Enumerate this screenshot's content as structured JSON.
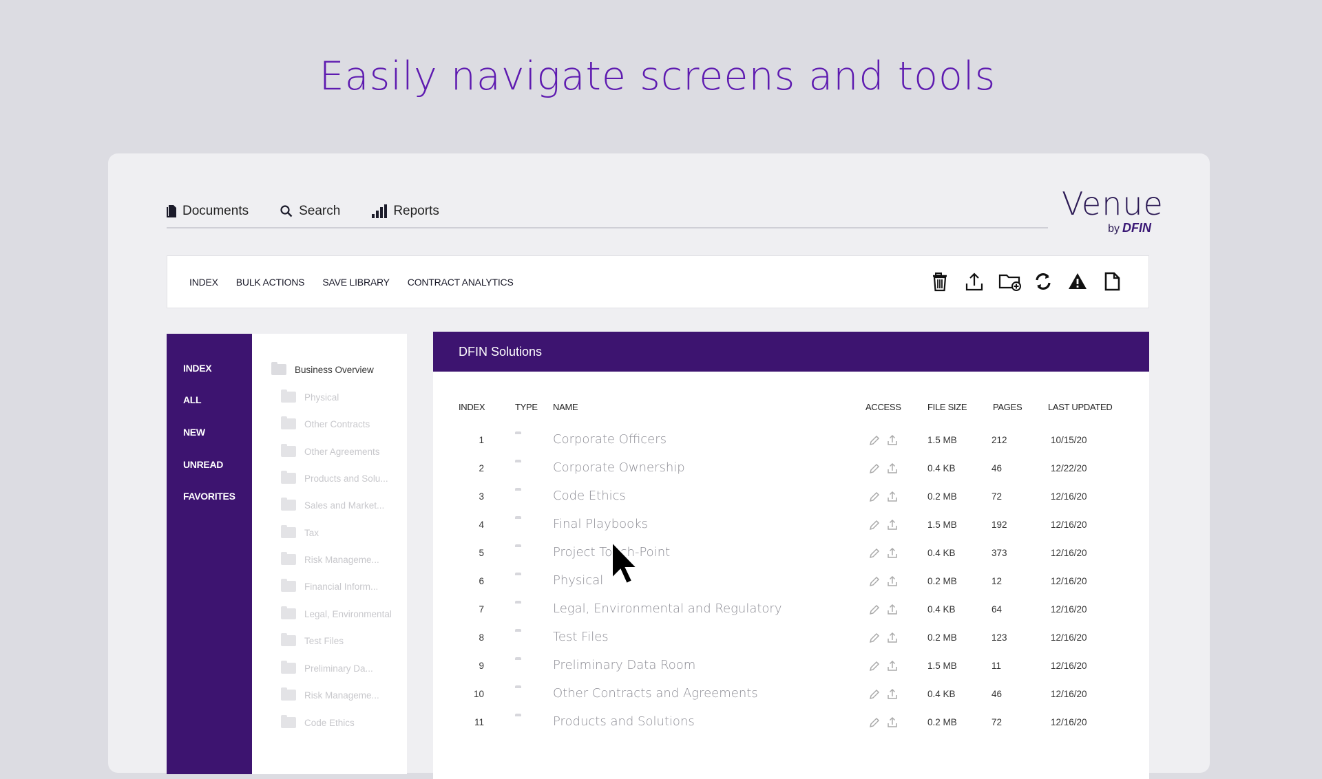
{
  "headline": "Easily navigate screens and tools",
  "brand": {
    "name": "Venue",
    "by": "by",
    "company": "DFIN"
  },
  "topnav": [
    {
      "label": "Documents",
      "icon": "documents-icon"
    },
    {
      "label": "Search",
      "icon": "search-icon"
    },
    {
      "label": "Reports",
      "icon": "reports-bar-chart-icon"
    }
  ],
  "toolbar": {
    "menu": [
      "INDEX",
      "BULK ACTIONS",
      "SAVE LIBRARY",
      "CONTRACT ANALYTICS"
    ],
    "icons": [
      "trash-icon",
      "upload-icon",
      "new-folder-icon",
      "refresh-icon",
      "warning-icon",
      "document-icon"
    ]
  },
  "leftnav": [
    "INDEX",
    "ALL",
    "NEW",
    "UNREAD",
    "FAVORITES"
  ],
  "tree": [
    "Business Overview",
    "Physical",
    "Other Contracts",
    "Other Agreements",
    "Products and Solu...",
    "Sales and Market...",
    "Tax",
    "Risk Manageme...",
    "Financial Inform...",
    "Legal, Environmental",
    "Test Files",
    "Preliminary Da...",
    "Risk Manageme...",
    "Code Ethics"
  ],
  "main": {
    "title": "DFIN Solutions",
    "columns": [
      "INDEX",
      "TYPE",
      "NAME",
      "ACCESS",
      "FILE SIZE",
      "PAGES",
      "LAST UPDATED"
    ],
    "rows": [
      {
        "index": "1",
        "name": "Corporate Officers",
        "size": "1.5 MB",
        "pages": "212",
        "updated": "10/15/20"
      },
      {
        "index": "2",
        "name": "Corporate Ownership",
        "size": "0.4 KB",
        "pages": "46",
        "updated": "12/22/20"
      },
      {
        "index": "3",
        "name": "Code Ethics",
        "size": "0.2 MB",
        "pages": "72",
        "updated": "12/16/20"
      },
      {
        "index": "4",
        "name": "Final Playbooks",
        "size": "1.5 MB",
        "pages": "192",
        "updated": "12/16/20"
      },
      {
        "index": "5",
        "name": "Project Touch-Point",
        "size": "0.4 KB",
        "pages": "373",
        "updated": "12/16/20"
      },
      {
        "index": "6",
        "name": "Physical",
        "size": "0.2 MB",
        "pages": "12",
        "updated": "12/16/20"
      },
      {
        "index": "7",
        "name": "Legal, Environmental and Regulatory",
        "size": "0.4 KB",
        "pages": "64",
        "updated": "12/16/20"
      },
      {
        "index": "8",
        "name": "Test Files",
        "size": "0.2 MB",
        "pages": "123",
        "updated": "12/16/20"
      },
      {
        "index": "9",
        "name": "Preliminary Data Room",
        "size": "1.5 MB",
        "pages": "11",
        "updated": "12/16/20"
      },
      {
        "index": "10",
        "name": "Other Contracts and Agreements",
        "size": "0.4 KB",
        "pages": "46",
        "updated": "12/16/20"
      },
      {
        "index": "11",
        "name": "Products and Solutions",
        "size": "0.2 MB",
        "pages": "72",
        "updated": "12/16/20"
      }
    ]
  }
}
